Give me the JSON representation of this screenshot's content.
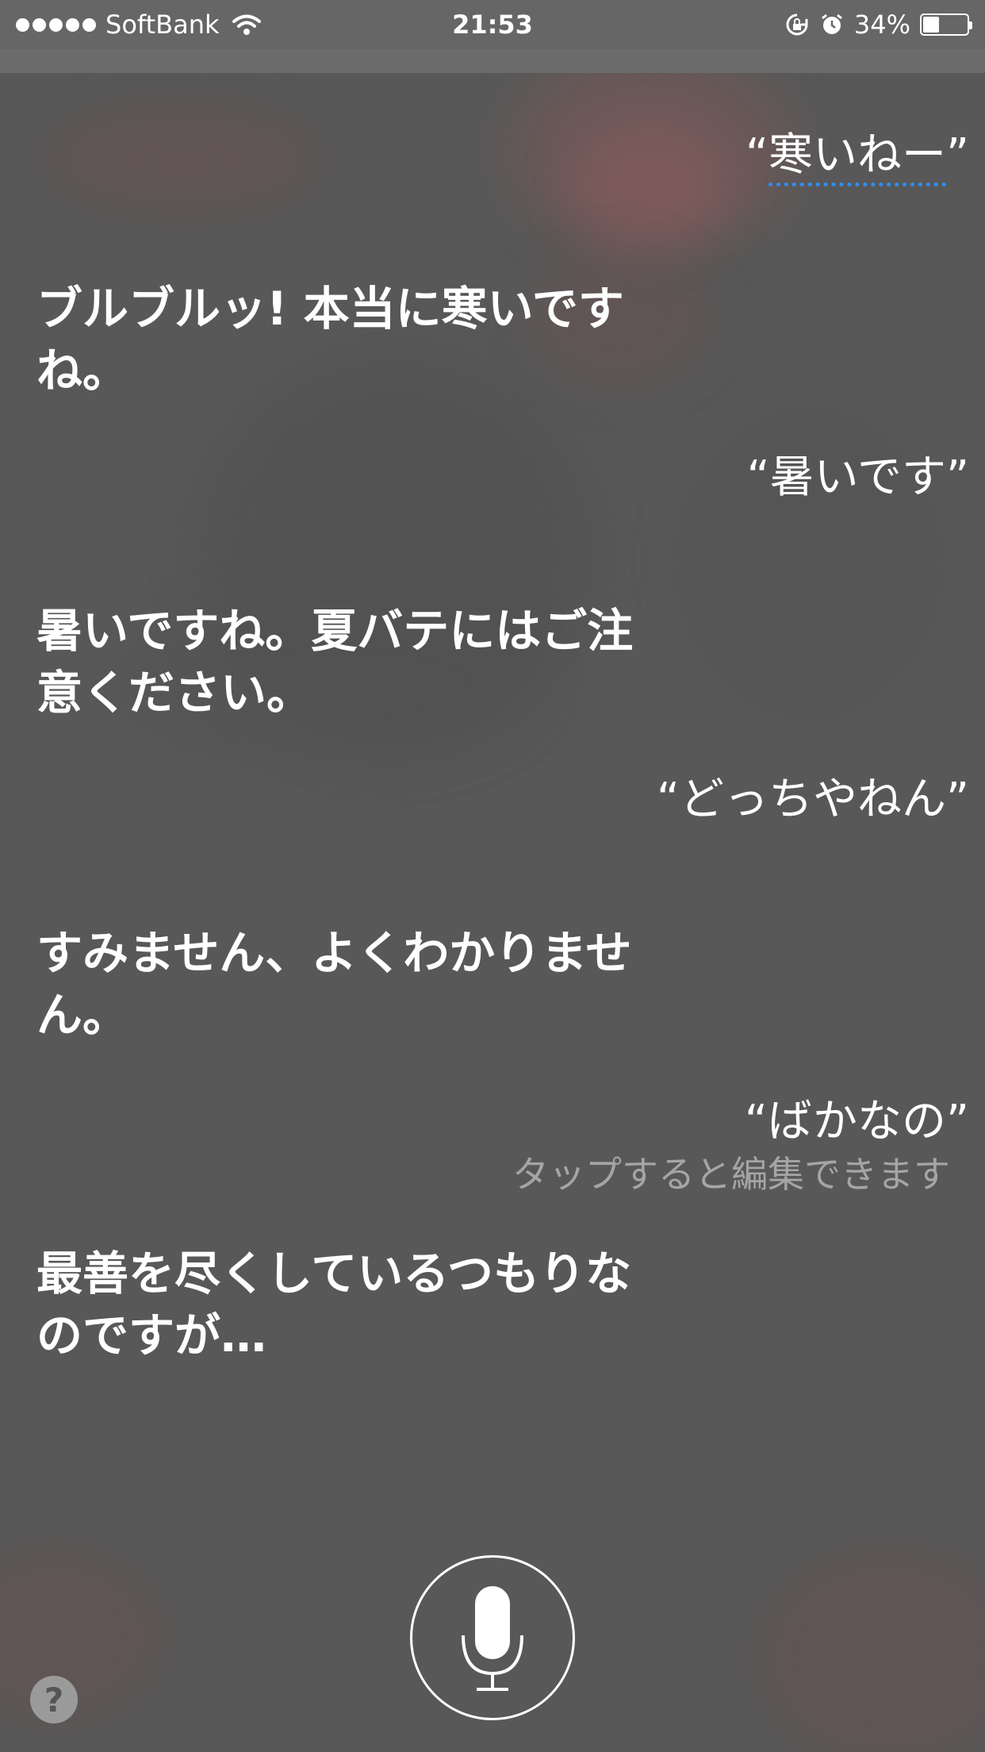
{
  "status_bar": {
    "signal_dots": 5,
    "carrier": "SoftBank",
    "time": "21:53",
    "battery_percent": "34%",
    "battery_level": 0.34,
    "icons": [
      "wifi-icon",
      "rotation-lock-icon",
      "alarm-icon",
      "battery-icon"
    ]
  },
  "conversation": [
    {
      "speaker": "user",
      "text": "“寒いねー”",
      "quote_open": "“",
      "core": "寒いねー",
      "quote_close": "”"
    },
    {
      "speaker": "siri",
      "line1": "ブルブルッ! 本当に寒いです",
      "line2": "ね。"
    },
    {
      "speaker": "user",
      "text": "“暑いです”"
    },
    {
      "speaker": "siri",
      "line1": "暑いですね。夏バテにはご注",
      "line2": "意ください。"
    },
    {
      "speaker": "user",
      "text": "“どっちやねん”"
    },
    {
      "speaker": "siri",
      "line1": "すみません、よくわかりませ",
      "line2": "ん。"
    },
    {
      "speaker": "user",
      "text": "“ばかなの”",
      "hint": "タップすると編集できます"
    },
    {
      "speaker": "siri",
      "line1": "最善を尽くしているつもりな",
      "line2": "のですが…"
    }
  ],
  "controls": {
    "mic_icon": "microphone-icon",
    "help_label": "?"
  },
  "colors": {
    "background": "#585858",
    "underline": "#2f8ef5",
    "hint": "#a5a5a5"
  }
}
